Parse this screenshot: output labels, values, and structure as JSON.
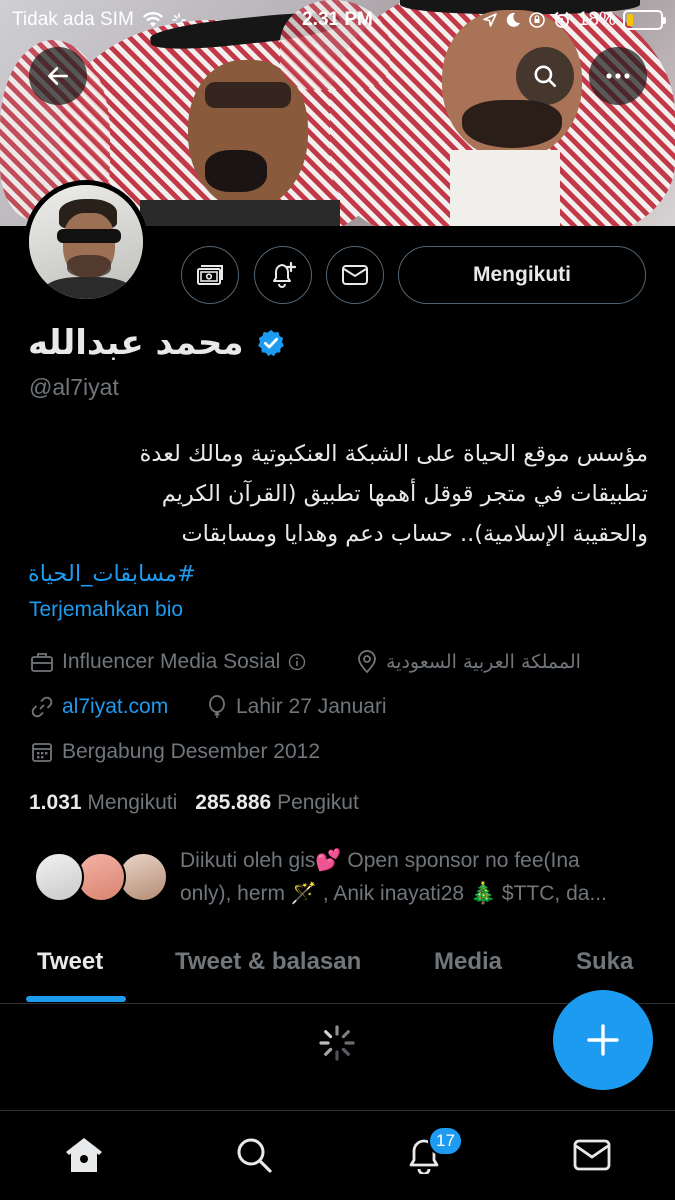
{
  "status_bar": {
    "carrier": "Tidak ada SIM",
    "time": "2.31 PM",
    "battery": "18%",
    "battery_level": 0.18
  },
  "header": {
    "back_icon": "arrow-left-icon",
    "search_icon": "search-icon",
    "more_icon": "more-horizontal-icon"
  },
  "profile": {
    "name": "محمد عبدالله",
    "verified": true,
    "handle": "@al7iyat",
    "bio_line1": "مؤسس موقع الحياة على الشبكة العنكبوتية ومالك لعدة",
    "bio_line2": "تطبيقات في متجر قوقل أهمها تطبيق (القرآن الكريم",
    "bio_line3": "والحقيبة الإسلامية).. حساب دعم وهدايا ومسابقات",
    "bio_hashtag": "#مسابقات_الحياة",
    "translate_label": "Terjemahkan bio",
    "category": "Influencer Media Sosial",
    "location": "المملكة العربية السعودية",
    "website": "al7iyat.com",
    "birthday": "Lahir 27 Januari",
    "joined": "Bergabung Desember 2012",
    "following_count": "1.031",
    "following_label": "Mengikuti",
    "followers_count": "285.886",
    "followers_label": "Pengikut",
    "followed_by_line1": "Diikuti oleh gis💕  Open sponsor no fee(Ina",
    "followed_by_line2": "only), herm 🪄 , Anik inayati28 🎄 $TTC, da..."
  },
  "actions": {
    "follow_label": "Mengikuti",
    "icons": [
      "subscriptions-icon",
      "notification-add-icon",
      "message-icon"
    ]
  },
  "tabs": [
    {
      "label": "Tweet",
      "active": true
    },
    {
      "label": "Tweet & balasan",
      "active": false
    },
    {
      "label": "Media",
      "active": false
    },
    {
      "label": "Suka",
      "active": false
    }
  ],
  "bottom_nav": {
    "items": [
      "home-icon",
      "search-icon",
      "notifications-icon",
      "messages-icon"
    ],
    "notifications_badge": "17"
  },
  "colors": {
    "accent": "#1d9bf0",
    "background": "#000000",
    "muted": "#71767b"
  }
}
